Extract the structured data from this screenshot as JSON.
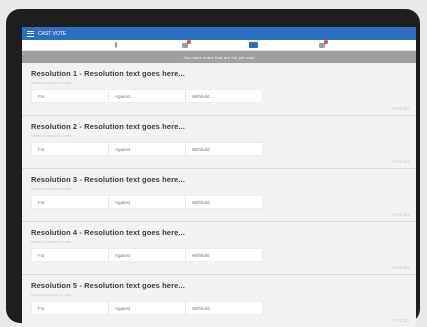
{
  "app": {
    "title": "CAST VOTE"
  },
  "tabs": [
    {
      "name": "tab-1",
      "icon": "bar-icon",
      "active": false,
      "badge": false
    },
    {
      "name": "tab-2",
      "icon": "list-icon",
      "active": false,
      "badge": true
    },
    {
      "name": "tab-3",
      "icon": "vote-icon",
      "active": true,
      "badge": false
    },
    {
      "name": "tab-4",
      "icon": "doc-icon",
      "active": false,
      "badge": true
    }
  ],
  "banner": "You have votes that are not yet cast",
  "resolutions": [
    {
      "title": "Resolution 1 - Resolution text goes here...",
      "subtitle": "Select a choice to vote",
      "options": [
        "For",
        "Against",
        "Withhold"
      ],
      "cancel": "CANCEL"
    },
    {
      "title": "Resolution 2 - Resolution text goes here...",
      "subtitle": "Select a choice to vote",
      "options": [
        "For",
        "Against",
        "Withhold"
      ],
      "cancel": "CANCEL"
    },
    {
      "title": "Resolution 3 - Resolution text goes here...",
      "subtitle": "Select a choice to vote",
      "options": [
        "For",
        "Against",
        "Withhold"
      ],
      "cancel": "CANCEL"
    },
    {
      "title": "Resolution 4 - Resolution text goes here...",
      "subtitle": "Select a choice to vote",
      "options": [
        "For",
        "Against",
        "Withhold"
      ],
      "cancel": "CANCEL"
    },
    {
      "title": "Resolution 5 - Resolution text goes here...",
      "subtitle": "Select a choice to vote",
      "options": [
        "For",
        "Against",
        "Withhold"
      ],
      "cancel": "CANCEL"
    }
  ],
  "colors": {
    "appbar": "#2b6fc1",
    "badge": "#d94a4a",
    "banner": "#9f9f9f"
  }
}
